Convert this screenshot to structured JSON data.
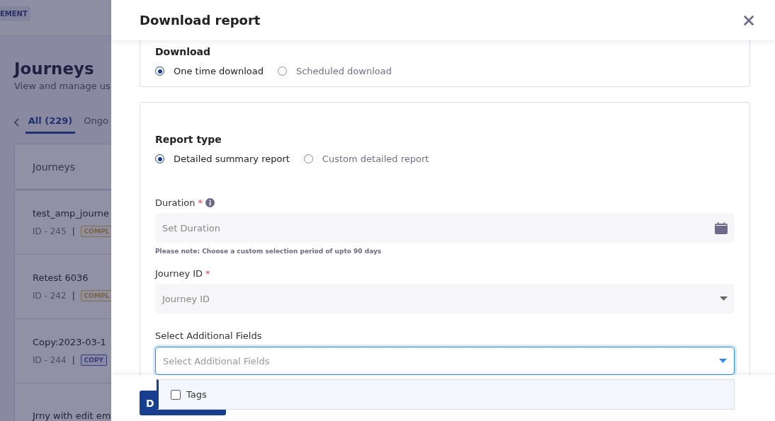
{
  "background": {
    "badge": "EMENT",
    "title": "Journeys",
    "subtitle": "View and manage us",
    "tabs": [
      {
        "label": "All (229)",
        "selected": true
      },
      {
        "label": "Ongo",
        "selected": false
      }
    ],
    "table": {
      "header": "Journeys",
      "rows": [
        {
          "name": "test_amp_journe",
          "id": "ID - 245",
          "separator": "|",
          "status": "COMPL",
          "kind": "completed"
        },
        {
          "name": "Retest 6036",
          "id": "ID - 242",
          "separator": "|",
          "status": "COMPL",
          "kind": "completed"
        },
        {
          "name": "Copy:2023-03-1",
          "id": "ID - 244",
          "separator": "|",
          "status": "COPY",
          "kind": "copy"
        },
        {
          "name": "Jrny with edit em"
        }
      ]
    }
  },
  "drawer": {
    "title": "Download report",
    "download": {
      "label": "Download",
      "options": [
        {
          "label": "One time download",
          "selected": true
        },
        {
          "label": "Scheduled download",
          "selected": false
        }
      ]
    },
    "report_type": {
      "label": "Report type",
      "options": [
        {
          "label": "Detailed summary report",
          "selected": true
        },
        {
          "label": "Custom detailed report",
          "selected": false
        }
      ]
    },
    "duration": {
      "label": "Duration",
      "required_mark": "*",
      "placeholder": "Set Duration",
      "note": "Please note: Choose a custom selection period of upto 90 days"
    },
    "journey_id": {
      "label": "Journey ID",
      "required_mark": "*",
      "placeholder": "Journey ID"
    },
    "additional_fields": {
      "label": "Select Additional Fields",
      "placeholder": "Select Additional Fields",
      "focused": true,
      "options": [
        {
          "label": "Tags",
          "checked": false
        }
      ]
    },
    "footer": {
      "button": "D"
    }
  }
}
